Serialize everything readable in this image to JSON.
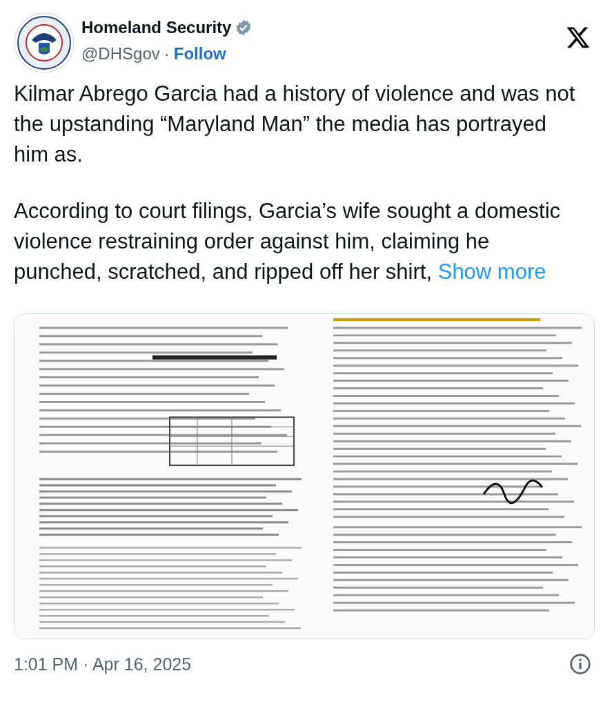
{
  "account": {
    "name": "Homeland Security",
    "verified": true,
    "handle": "@DHSgov",
    "separator": "·",
    "follow": "Follow"
  },
  "paragraphs": [
    "Kilmar Abrego Garcia had a history of violence and was not the upstanding “Maryland Man” the media has portrayed him as.",
    "According to court filings, Garcia’s wife sought a domestic violence restraining order against him, claiming he punched, scratched, and ripped off her shirt,"
  ],
  "show_more": "Show more",
  "timestamp": "1:01 PM · Apr 16, 2025"
}
